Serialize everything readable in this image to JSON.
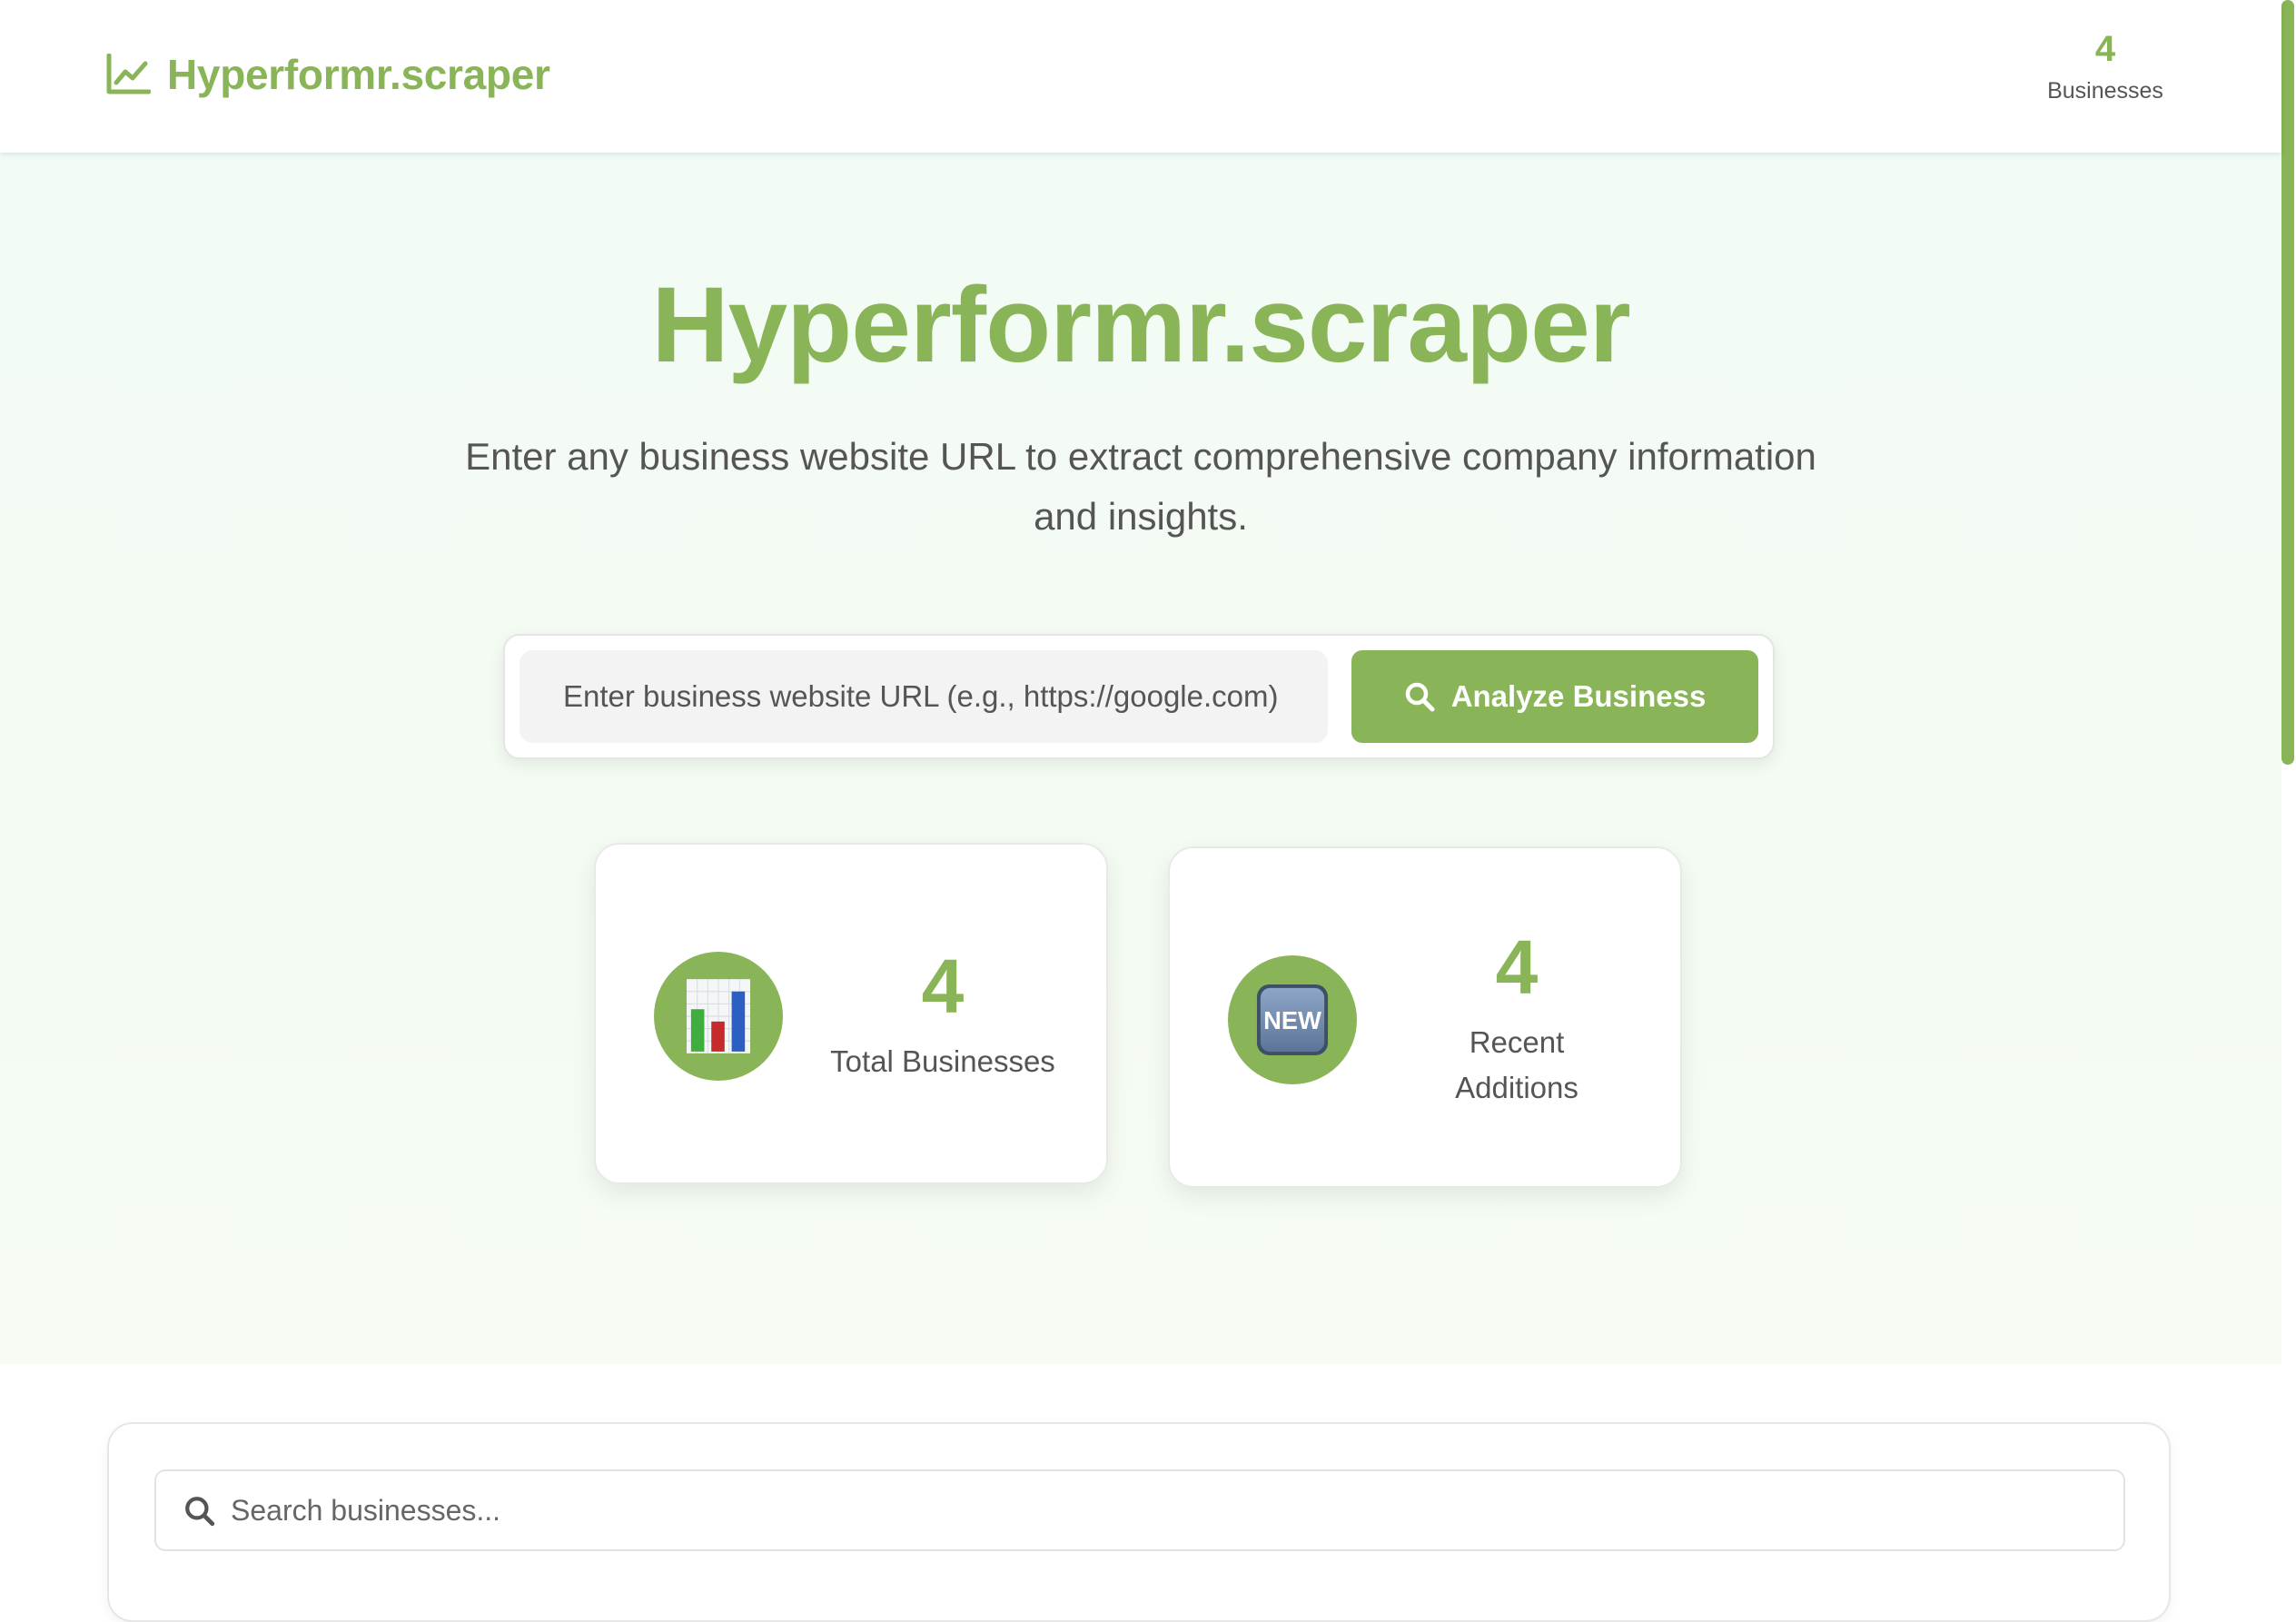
{
  "colors": {
    "accent": "#89b457",
    "text_muted": "#555555",
    "hero_bg": "#f3fbf3"
  },
  "header": {
    "brand_icon": "chart-line-icon",
    "brand_name": "Hyperformr.scraper",
    "stat_value": "4",
    "stat_label": "Businesses"
  },
  "hero": {
    "title": "Hyperformr.scraper",
    "subtitle": "Enter any business website URL to extract comprehensive company information and insights.",
    "url_input": {
      "placeholder": "Enter business website URL (e.g., https://google.com)",
      "value": ""
    },
    "analyze_button": {
      "icon": "search-icon",
      "label": "Analyze Business"
    }
  },
  "stats": [
    {
      "icon": "bar-chart-emoji-icon",
      "value": "4",
      "label": "Total Businesses"
    },
    {
      "icon": "new-badge-emoji-icon",
      "badge_text": "NEW",
      "value": "4",
      "label": "Recent Additions"
    }
  ],
  "business_search": {
    "icon": "search-icon",
    "placeholder": "Search businesses...",
    "value": ""
  }
}
